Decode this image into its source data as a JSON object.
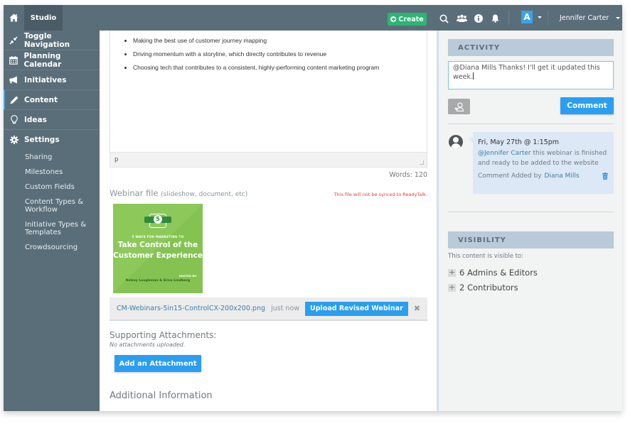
{
  "topbar": {
    "home_icon": "home-icon",
    "studio_label": "Studio",
    "create_label": "Create",
    "icons": [
      "search-icon",
      "team-icon",
      "info-icon",
      "bell-icon"
    ],
    "account_badge": "A",
    "user_name": "Jennifer Carter"
  },
  "sidebar": {
    "items": [
      {
        "label": "Toggle Navigation",
        "icon": "collapse-icon"
      },
      {
        "label": "Planning Calendar",
        "icon": "calendar-icon"
      },
      {
        "label": "Initiatives",
        "icon": "megaphone-icon"
      },
      {
        "label": "Content",
        "icon": "pencil-icon",
        "active": true
      },
      {
        "label": "Ideas",
        "icon": "lightbulb-icon"
      },
      {
        "label": "Settings",
        "icon": "gear-icon"
      }
    ],
    "settings_sub": [
      "Sharing",
      "Milestones",
      "Custom Fields",
      "Content Types & Workflow",
      "Initiative Types & Templates",
      "Crowdsourcing"
    ]
  },
  "editor": {
    "bullets": [
      "Making the best use of customer journey mapping",
      "Driving momentum with a storyline, which directly contributes to revenue",
      "Choosing tech that contributes to a consistent, highly-performing content marketing program"
    ],
    "status_path": "p",
    "word_count": "Words: 120"
  },
  "webinar": {
    "label": "Webinar file",
    "hint": "(slideshow, document, etc)",
    "sync_warning": "This file will not be synced to ReadyTalk.",
    "thumbnail": {
      "badge_left": "IN",
      "badge_num": "5",
      "badge_right": "15",
      "kicker": "5 WAYS FOR MARKETING TO",
      "title_line1": "Take Control of the",
      "title_line2": "Customer Experience",
      "hosted_by": "HOSTED BY:",
      "hosts": "Kelsey Loughman & Erica Lindberg"
    },
    "file_name": "CM-Webinars-5in15-ControlCX-200x200.png",
    "file_time": "just now",
    "upload_label": "Upload Revised Webinar",
    "remove_glyph": "✖"
  },
  "attachments": {
    "label": "Supporting Attachments:",
    "empty_text": "No attachments uploaded.",
    "add_label": "Add an Attachment"
  },
  "additional_info": "Additional Information",
  "activity": {
    "heading": "ACTIVITY",
    "draft_text": "@Diana Mills  Thanks! I'll get it updated this week.",
    "comment_label": "Comment",
    "comments": [
      {
        "date": "Fri, May 27th @ 1:15pm",
        "mention": "@Jennifer Carter",
        "text": "this webinar is finished and ready to be added to the website",
        "added_by_label": "Comment Added by",
        "author": "Diana Mills"
      }
    ]
  },
  "visibility": {
    "heading": "VISIBILITY",
    "intro": "This content is visible to:",
    "groups": [
      "6 Admins & Editors",
      "2 Contributors"
    ]
  },
  "colors": {
    "chrome": "#5a6e79",
    "create_green": "#2bb673",
    "primary_blue": "#2a9ef0",
    "warning_red": "#e0442b",
    "section_head": "#b9cad8"
  }
}
